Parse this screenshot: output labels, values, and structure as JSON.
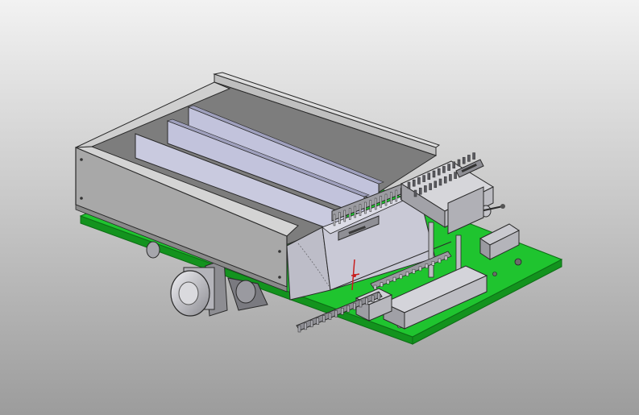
{
  "viewport": {
    "background_top": "#f2f2f2",
    "background_bottom": "#9c9c9c"
  },
  "colors": {
    "base_plate": "#1fc42f",
    "base_plate_side": "#13931e",
    "base_plate_edge": "#0d6e15",
    "housing_front": "#a8a8a8",
    "housing_top": "#cfcfcf",
    "housing_inner": "#7d7d7d",
    "panel": "#c2c3dc",
    "panel_dark": "#9fa0bd",
    "tray": "#c9c9d6",
    "steel": "#b8b8bc",
    "steel_dark": "#6f6f74",
    "block": "#c9c9cf",
    "motor": "#d2d2d8",
    "outline": "#2a2a2a",
    "accent_red": "#c81e1e"
  }
}
